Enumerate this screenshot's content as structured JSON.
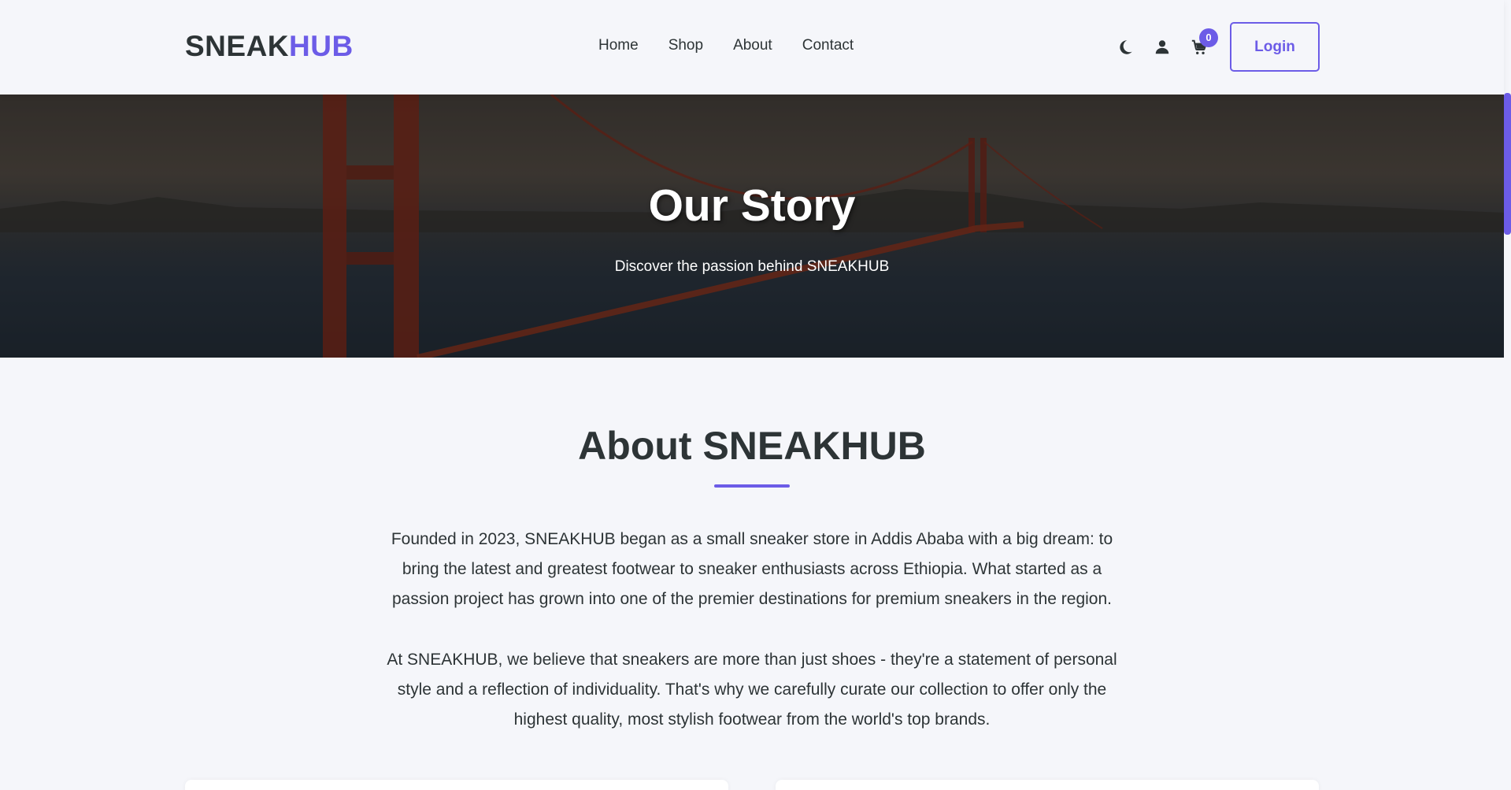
{
  "brand": {
    "part1": "SNEAK",
    "part2": "HUB"
  },
  "nav": {
    "links": [
      "Home",
      "Shop",
      "About",
      "Contact"
    ]
  },
  "actions": {
    "theme_icon": "moon-icon",
    "user_icon": "user-icon",
    "cart_icon": "cart-icon",
    "cart_count": "0",
    "login_label": "Login"
  },
  "hero": {
    "title": "Our Story",
    "subtitle": "Discover the passion behind SNEAKHUB"
  },
  "about": {
    "title": "About SNEAKHUB",
    "paragraph1": "Founded in 2023, SNEAKHUB began as a small sneaker store in Addis Ababa with a big dream: to bring the latest and greatest footwear to sneaker enthusiasts across Ethiopia. What started as a passion project has grown into one of the premier destinations for premium sneakers in the region.",
    "paragraph2": "At SNEAKHUB, we believe that sneakers are more than just shoes - they're a statement of personal style and a reflection of individuality. That's why we carefully curate our collection to offer only the highest quality, most stylish footwear from the world's top brands."
  },
  "colors": {
    "accent": "#6c5ce7",
    "text": "#2d3436",
    "background": "#f5f6fa"
  }
}
